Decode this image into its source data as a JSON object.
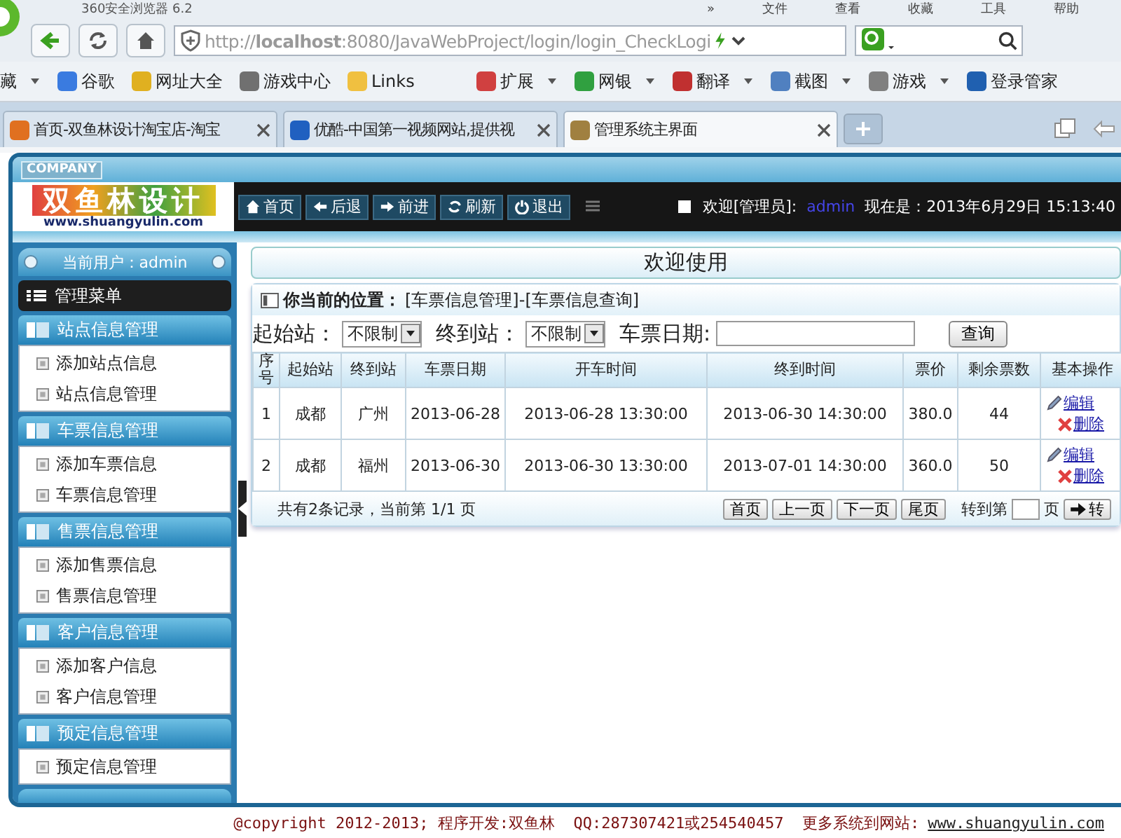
{
  "browser": {
    "title": "360安全浏览器 6.2",
    "menu": [
      "»",
      "文件",
      "查看",
      "收藏",
      "工具",
      "帮助"
    ],
    "address": "http://**localhost**:8080/JavaWebProject/login/login_CheckLogi",
    "bookmarks": [
      {
        "label": "藏",
        "menu": true
      },
      {
        "label": "谷歌",
        "color": "#3a7be0",
        "menu": false
      },
      {
        "label": "网址大全",
        "color": "#e0b020",
        "menu": false
      },
      {
        "label": "游戏中心",
        "color": "#707070",
        "menu": false
      },
      {
        "label": "Links",
        "color": "#f0c040",
        "menu": false
      },
      {
        "label": "扩展",
        "color": "#d04040",
        "menu": true
      },
      {
        "label": "网银",
        "color": "#30a040",
        "menu": true
      },
      {
        "label": "翻译",
        "color": "#c03030",
        "menu": true
      },
      {
        "label": "截图",
        "color": "#5080c0",
        "menu": true
      },
      {
        "label": "游戏",
        "color": "#808080",
        "menu": true
      },
      {
        "label": "登录管家",
        "color": "#2060b0",
        "menu": false
      }
    ],
    "tabs": [
      {
        "label": "首页-双鱼林设计淘宝店-淘宝",
        "selected": false,
        "color": "#e07020"
      },
      {
        "label": "优酷-中国第一视频网站,提供视",
        "selected": false,
        "color": "#2060c0"
      },
      {
        "label": "管理系统主界面",
        "selected": true,
        "color": "#a08040"
      }
    ]
  },
  "header": {
    "company": "COMPANY",
    "logo_text": "双鱼林设计",
    "logo_url": "www.shuangyulin.com",
    "nav": [
      {
        "label": "首页",
        "kind": "home"
      },
      {
        "label": "后退",
        "kind": "back"
      },
      {
        "label": "前进",
        "kind": "forward"
      },
      {
        "label": "刷新",
        "kind": "refresh"
      },
      {
        "label": "退出",
        "kind": "power"
      }
    ],
    "welcome": "欢迎[管理员]:",
    "user": "admin",
    "time": "现在是：2013年6月29日 15:13:40"
  },
  "sidebar": {
    "current_user": "当前用户：admin",
    "menu_title": "管理菜单",
    "groups": [
      {
        "title": "站点信息管理",
        "items": [
          "添加站点信息",
          "站点信息管理"
        ]
      },
      {
        "title": "车票信息管理",
        "items": [
          "添加车票信息",
          "车票信息管理"
        ]
      },
      {
        "title": "售票信息管理",
        "items": [
          "添加售票信息",
          "售票信息管理"
        ]
      },
      {
        "title": "客户信息管理",
        "items": [
          "添加客户信息",
          "客户信息管理"
        ]
      },
      {
        "title": "预定信息管理",
        "items": [
          "预定信息管理"
        ]
      }
    ]
  },
  "content": {
    "banner": "欢迎使用",
    "location_label": "你当前的位置：",
    "location": "[车票信息管理]-[车票信息查询]",
    "filters": {
      "start_label": "起始站：",
      "start_value": "不限制",
      "end_label": "终到站：",
      "end_value": "不限制",
      "date_label": "车票日期:",
      "query_button": "查询"
    },
    "table": {
      "columns": [
        "序号",
        "起始站",
        "终到站",
        "车票日期",
        "开车时间",
        "终到时间",
        "票价",
        "剩余票数",
        "基本操作"
      ],
      "rows": [
        {
          "cells": [
            "1",
            "成都",
            "广州",
            "2013-06-28",
            "2013-06-28 13:30:00",
            "2013-06-30 14:30:00",
            "380.0",
            "44"
          ],
          "edit": "编辑",
          "delete": "删除"
        },
        {
          "cells": [
            "2",
            "成都",
            "福州",
            "2013-06-30",
            "2013-06-30 13:30:00",
            "2013-07-01 14:30:00",
            "360.0",
            "50"
          ],
          "edit": "编辑",
          "delete": "删除"
        }
      ]
    },
    "pager": {
      "summary": "共有2条记录，当前第 1/1 页",
      "buttons": [
        "首页",
        "上一页",
        "下一页",
        "尾页"
      ],
      "goto_label": "转到第",
      "page_unit": "页",
      "go_button": "转"
    }
  },
  "footer": {
    "text": "@copyright 2012-2013; 程序开发:双鱼林  QQ:287307421或254540457  更多系统到网站:",
    "link": "www.shuangyulin.com"
  }
}
